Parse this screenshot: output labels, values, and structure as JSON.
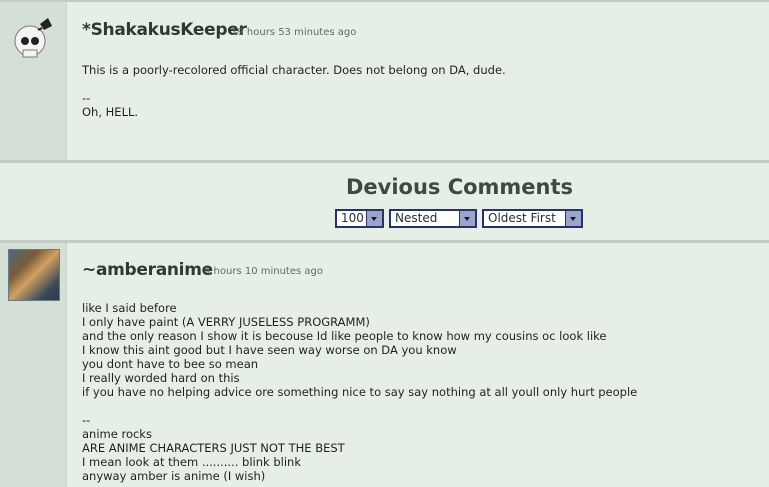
{
  "comment1": {
    "author": "*ShakakusKeeper",
    "time": "19 hours 53 minutes ago",
    "lines": [
      "This is a poorly-recolored official character. Does not belong on DA, dude.",
      "",
      "--",
      "Oh, HELL."
    ]
  },
  "divider": {
    "title": "Devious Comments",
    "per_page": "100",
    "mode": "Nested",
    "order": "Oldest First"
  },
  "comment2": {
    "author": "~amberanime",
    "time": "4 hours 10 minutes ago",
    "lines": [
      "like I said before",
      "I only have paint (A VERRY JUSELESS PROGRAMM)",
      "and the only reason I show it is becouse Id like people to know how my cousins oc look like",
      "I know this aint good but I have seen way worse on DA you know",
      "you dont have to bee so mean",
      "I really worded hard on this",
      "if you have no helping advice ore something nice to say say nothing at all youll only hurt people",
      "",
      "--",
      "anime rocks",
      "ARE ANIME CHARACTERS JUST NOT THE BEST",
      "I mean look at them .......... blink blink",
      "anyway amber is anime (I wish)"
    ]
  },
  "icons": {
    "avatar1": "skull-avatar-icon",
    "avatar2": "anime-character-avatar"
  }
}
